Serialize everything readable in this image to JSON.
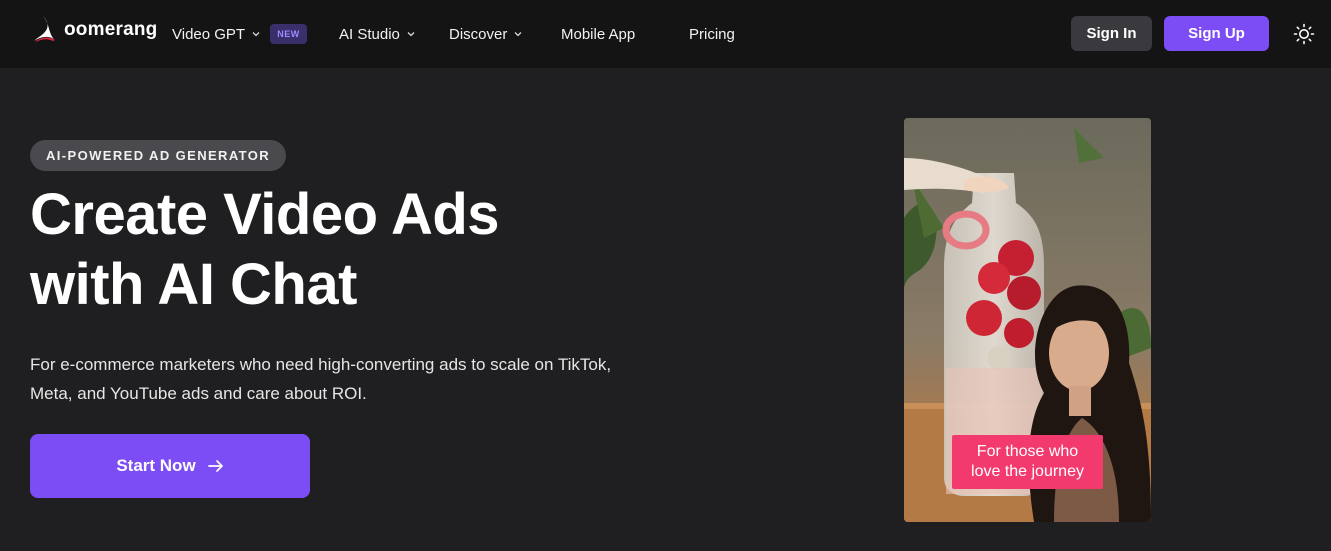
{
  "brand": {
    "name": "oomerang",
    "accent": "#7c4cf5"
  },
  "nav": {
    "items": [
      {
        "label": "Video GPT",
        "has_dropdown": true
      },
      {
        "label": "AI Studio",
        "has_dropdown": true
      },
      {
        "label": "Discover",
        "has_dropdown": true
      },
      {
        "label": "Mobile App",
        "has_dropdown": false
      },
      {
        "label": "Pricing",
        "has_dropdown": false
      }
    ],
    "badge": "NEW",
    "sign_in": "Sign In",
    "sign_up": "Sign Up",
    "theme_icon": "sun-icon"
  },
  "hero": {
    "eyebrow": "AI-POWERED AD GENERATOR",
    "headline_line1": "Create Video Ads",
    "headline_line2": "with AI Chat",
    "subtext_line1": "For e-commerce marketers who need high-converting ads to scale on TikTok,",
    "subtext_line2": "Meta, and YouTube ads and care about ROI.",
    "cta_label": "Start Now",
    "cta_icon": "arrow-right-icon"
  },
  "video": {
    "caption_line1": "For those who",
    "caption_line2": "love the journey",
    "caption_color": "#f23a6e"
  }
}
